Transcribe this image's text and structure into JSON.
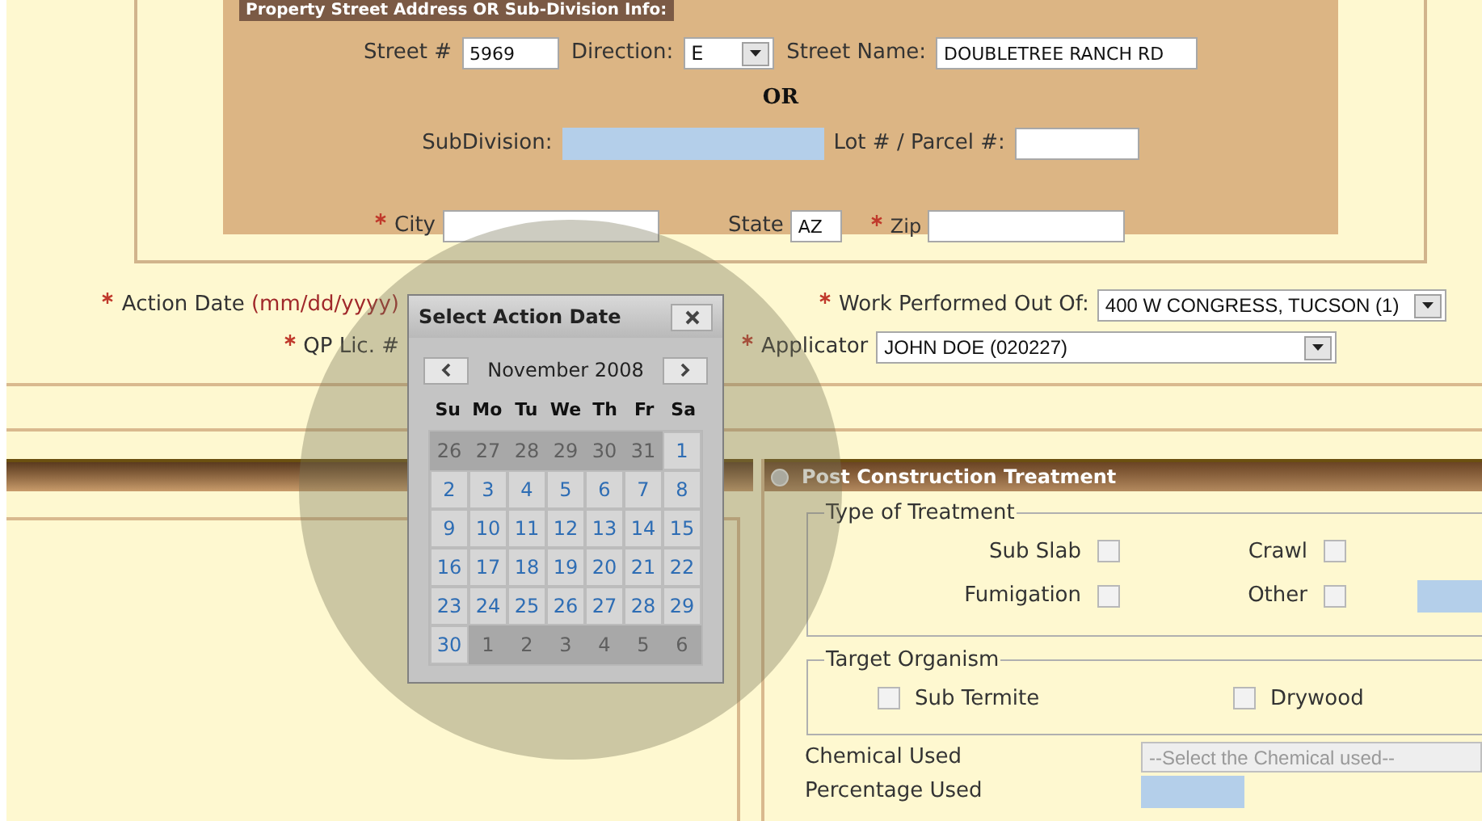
{
  "address_panel": {
    "title": "Property Street Address OR Sub-Division Info:",
    "street_number": {
      "label": "Street #",
      "value": "5969"
    },
    "direction": {
      "label": "Direction:",
      "value": "E"
    },
    "street_name": {
      "label": "Street Name:",
      "value": "DOUBLETREE RANCH RD"
    },
    "separator": "OR",
    "subdivision": {
      "label": "SubDivision:"
    },
    "lot_parcel": {
      "label": "Lot # / Parcel #:"
    }
  },
  "location": {
    "city": {
      "label": "City",
      "required": true
    },
    "state": {
      "label": "State",
      "value": "AZ"
    },
    "zip": {
      "label": "Zip",
      "required": true
    }
  },
  "action_date": {
    "label": "Action Date",
    "hint": "(mm/dd/yyyy)",
    "required": true
  },
  "work_performed": {
    "label": "Work Performed Out Of:",
    "value": "400 W CONGRESS, TUCSON (1)",
    "required": true
  },
  "qp_license": {
    "label": "QP Lic. #",
    "required": true
  },
  "applicator": {
    "label": "Applicator",
    "value": "JOHN DOE (020227)",
    "required": true
  },
  "date_picker": {
    "title": "Select Action Date",
    "month": "November 2008",
    "weekdays": [
      "Su",
      "Mo",
      "Tu",
      "We",
      "Th",
      "Fr",
      "Sa"
    ],
    "days": [
      {
        "label": "26",
        "outside": true
      },
      {
        "label": "27",
        "outside": true
      },
      {
        "label": "28",
        "outside": true
      },
      {
        "label": "29",
        "outside": true
      },
      {
        "label": "30",
        "outside": true
      },
      {
        "label": "31",
        "outside": true
      },
      {
        "label": "1",
        "outside": false
      },
      {
        "label": "2",
        "outside": false
      },
      {
        "label": "3",
        "outside": false
      },
      {
        "label": "4",
        "outside": false
      },
      {
        "label": "5",
        "outside": false
      },
      {
        "label": "6",
        "outside": false
      },
      {
        "label": "7",
        "outside": false
      },
      {
        "label": "8",
        "outside": false
      },
      {
        "label": "9",
        "outside": false
      },
      {
        "label": "10",
        "outside": false
      },
      {
        "label": "11",
        "outside": false
      },
      {
        "label": "12",
        "outside": false
      },
      {
        "label": "13",
        "outside": false
      },
      {
        "label": "14",
        "outside": false
      },
      {
        "label": "15",
        "outside": false
      },
      {
        "label": "16",
        "outside": false
      },
      {
        "label": "17",
        "outside": false
      },
      {
        "label": "18",
        "outside": false
      },
      {
        "label": "19",
        "outside": false
      },
      {
        "label": "20",
        "outside": false
      },
      {
        "label": "21",
        "outside": false
      },
      {
        "label": "22",
        "outside": false
      },
      {
        "label": "23",
        "outside": false
      },
      {
        "label": "24",
        "outside": false
      },
      {
        "label": "25",
        "outside": false
      },
      {
        "label": "26",
        "outside": false
      },
      {
        "label": "27",
        "outside": false
      },
      {
        "label": "28",
        "outside": false
      },
      {
        "label": "29",
        "outside": false
      },
      {
        "label": "30",
        "outside": false
      },
      {
        "label": "1",
        "outside": true
      },
      {
        "label": "2",
        "outside": true
      },
      {
        "label": "3",
        "outside": true
      },
      {
        "label": "4",
        "outside": true
      },
      {
        "label": "5",
        "outside": true
      },
      {
        "label": "6",
        "outside": true
      }
    ]
  },
  "post_construction": {
    "title": "Post Construction Treatment",
    "type_of_treatment": {
      "legend": "Type of Treatment",
      "options": [
        {
          "label": "Sub Slab",
          "checked": false
        },
        {
          "label": "Crawl",
          "checked": false
        },
        {
          "label": "Fumigation",
          "checked": false
        },
        {
          "label": "Other",
          "checked": false
        }
      ]
    },
    "target_organism": {
      "legend": "Target Organism",
      "options": [
        {
          "label": "Sub Termite",
          "checked": false
        },
        {
          "label": "Drywood",
          "checked": false
        }
      ]
    },
    "chemical_used": {
      "label": "Chemical Used",
      "placeholder": "--Select the Chemical used--",
      "disabled": true
    },
    "percentage_used": {
      "label": "Percentage Used"
    }
  }
}
